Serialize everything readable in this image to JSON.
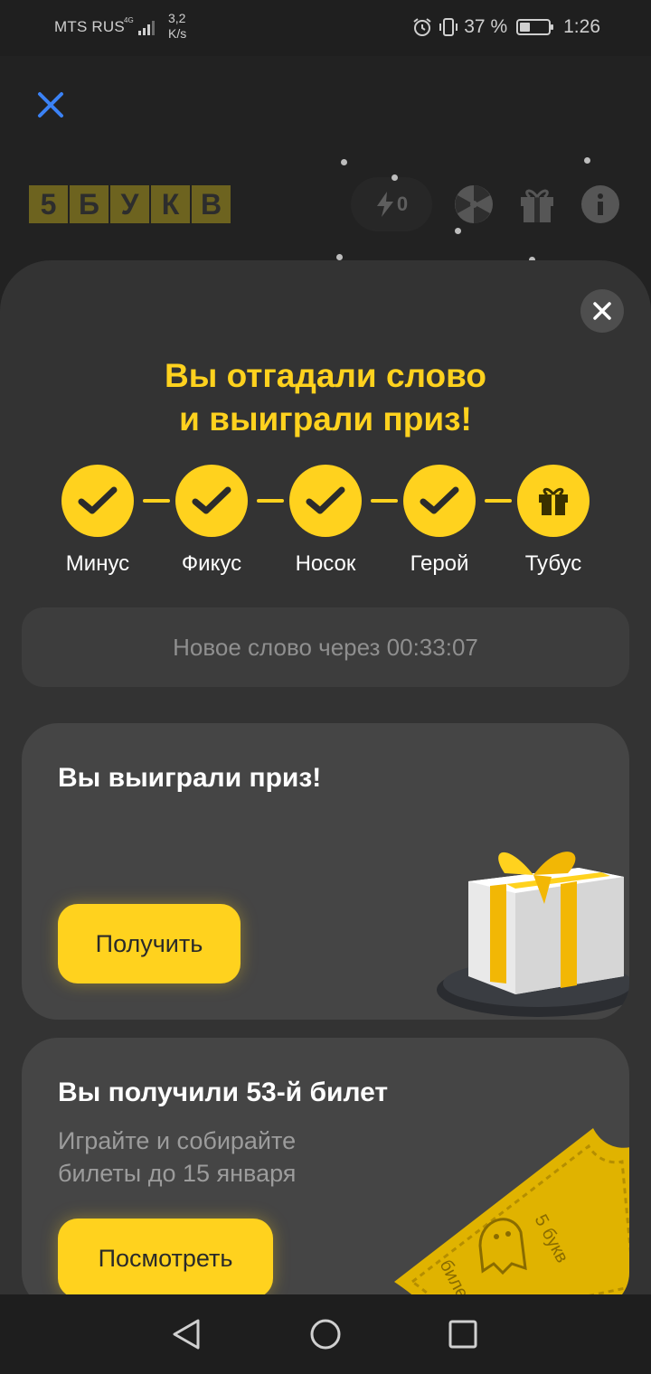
{
  "status_bar": {
    "carrier": "MTS RUS",
    "network": "4G",
    "speed_value": "3,2",
    "speed_unit": "K/s",
    "battery_text": "37 %",
    "battery_level": 0.37,
    "time": "1:26"
  },
  "header": {
    "logo_letters": [
      "5",
      "Б",
      "У",
      "К",
      "В"
    ],
    "energy_count": "0"
  },
  "modal": {
    "title_line1": "Вы отгадали слово",
    "title_line2": "и выиграли приз!",
    "steps": [
      {
        "label": "Минус",
        "icon": "check-icon"
      },
      {
        "label": "Фикус",
        "icon": "check-icon"
      },
      {
        "label": "Носок",
        "icon": "check-icon"
      },
      {
        "label": "Герой",
        "icon": "check-icon"
      },
      {
        "label": "Тубус",
        "icon": "gift-icon"
      }
    ],
    "timer_text": "Новое слово через 00:33:07",
    "prize_card": {
      "title": "Вы выиграли приз!",
      "button": "Получить"
    },
    "ticket_card": {
      "title": "Вы получили 53-й билет",
      "subtitle": "Играйте и собирайте билеты до 15 января",
      "button": "Посмотреть",
      "ticket_brand": "5 букв",
      "ticket_word": "билет"
    }
  },
  "colors": {
    "accent": "#ffd21e",
    "sheet_bg": "#333333",
    "card_bg": "#454545"
  }
}
